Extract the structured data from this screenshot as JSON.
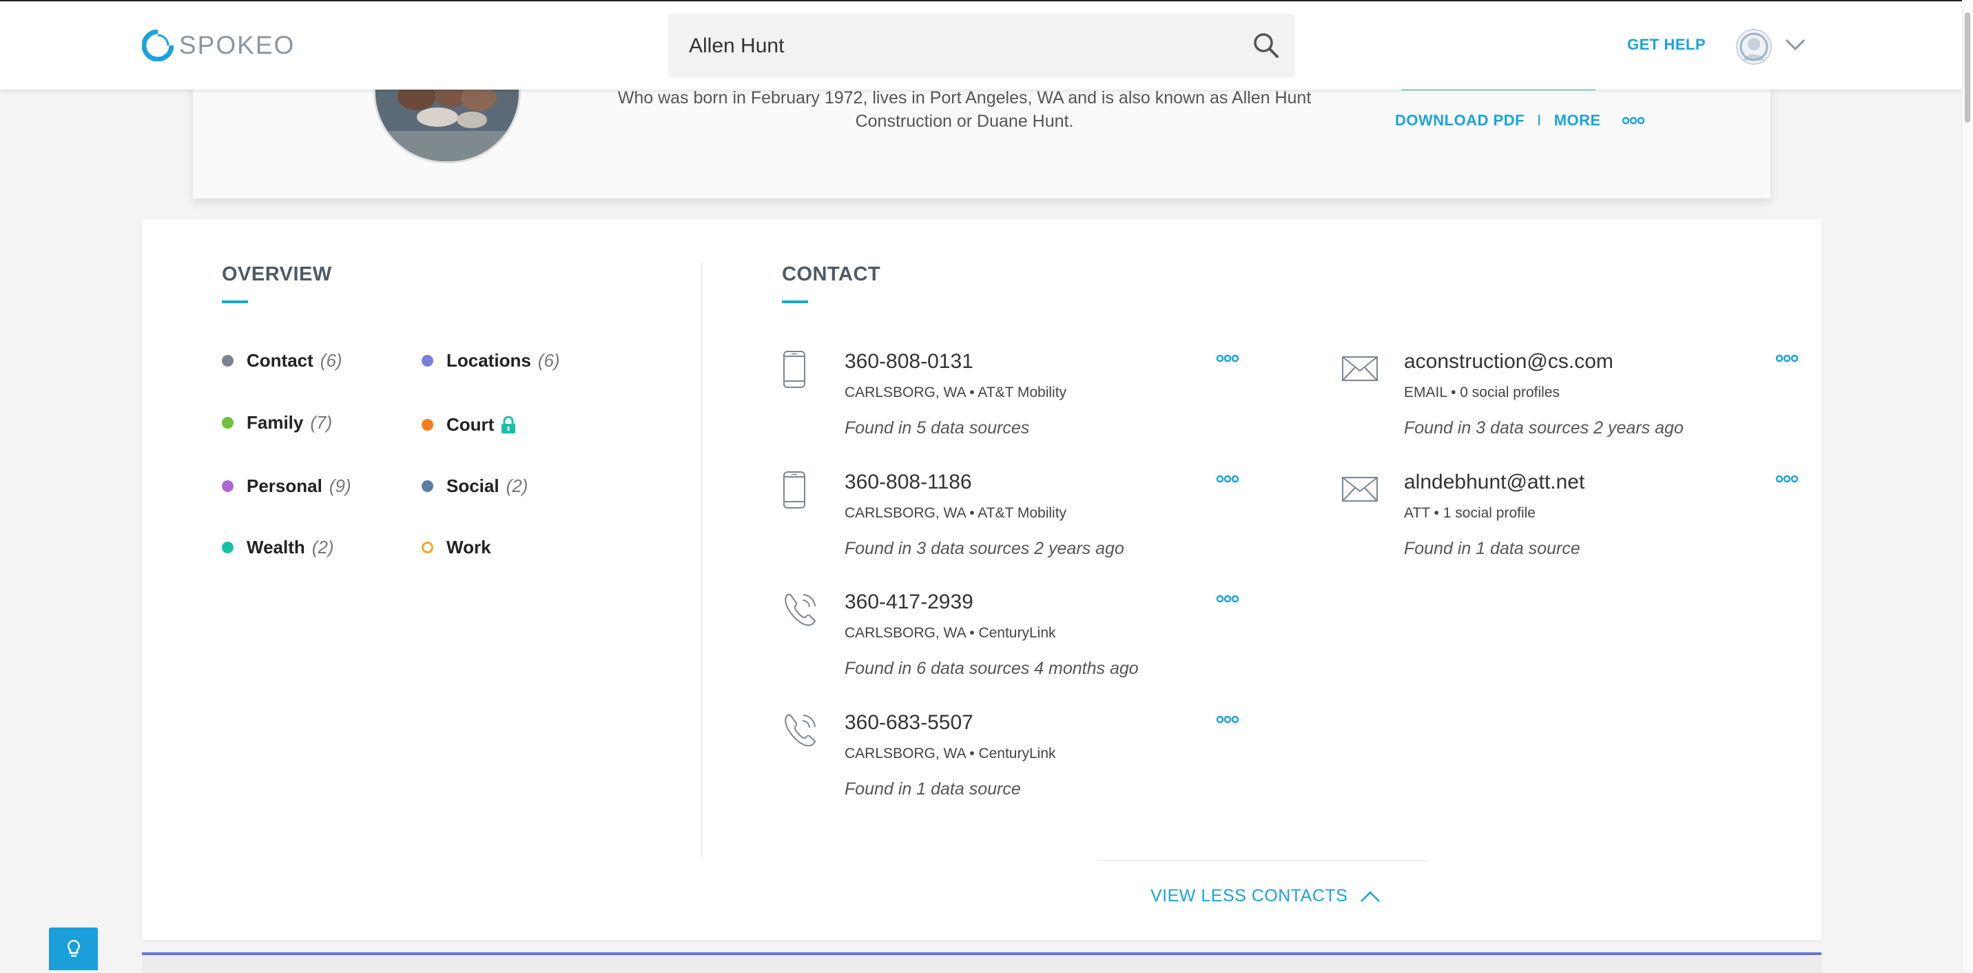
{
  "header": {
    "brand": "SPOKEO",
    "search_value": "Allen Hunt",
    "get_help": "GET HELP"
  },
  "profile": {
    "description": "Who was born in February 1972, lives in Port Angeles, WA and is also known as Allen Hunt Construction or Duane Hunt.",
    "download_pdf": "DOWNLOAD PDF",
    "separator": "I",
    "more": "MORE"
  },
  "overview": {
    "title": "OVERVIEW",
    "items": [
      {
        "label": "Contact",
        "count": "(6)",
        "color": "#7b8591"
      },
      {
        "label": "Locations",
        "count": "(6)",
        "color": "#7b7fdc"
      },
      {
        "label": "Family",
        "count": "(7)",
        "color": "#6cc23a"
      },
      {
        "label": "Court",
        "count": "",
        "color": "#f57c20",
        "locked": true
      },
      {
        "label": "Personal",
        "count": "(9)",
        "color": "#b064d8"
      },
      {
        "label": "Social",
        "count": "(2)",
        "color": "#5b7ea8"
      },
      {
        "label": "Wealth",
        "count": "(2)",
        "color": "#18c1a6"
      },
      {
        "label": "Work",
        "count": "",
        "color": "#f5a623",
        "hollow": true
      }
    ]
  },
  "contact": {
    "title": "CONTACT",
    "phones": [
      {
        "number": "360-808-0131",
        "sub": "CARLSBORG, WA • AT&T Mobility",
        "found": "Found in 5 data sources",
        "icon": "mobile-phone-icon"
      },
      {
        "number": "360-808-1186",
        "sub": "CARLSBORG, WA • AT&T Mobility",
        "found": "Found in 3 data sources 2 years ago",
        "icon": "mobile-phone-icon"
      },
      {
        "number": "360-417-2939",
        "sub": "CARLSBORG, WA • CenturyLink",
        "found": "Found in 6 data sources 4 months ago",
        "icon": "landline-phone-icon"
      },
      {
        "number": "360-683-5507",
        "sub": "CARLSBORG, WA • CenturyLink",
        "found": "Found in 1 data source",
        "icon": "landline-phone-icon"
      }
    ],
    "emails": [
      {
        "address": "aconstruction@cs.com",
        "sub": "EMAIL • 0 social profiles",
        "found": "Found in 3 data sources 2 years ago",
        "icon": "envelope-icon"
      },
      {
        "address": "alndebhunt@att.net",
        "sub": "ATT • 1 social profile",
        "found": "Found in 1 data source",
        "icon": "envelope-icon"
      }
    ],
    "view_less": "VIEW LESS CONTACTS"
  },
  "colors": {
    "accent": "#1aa3dc",
    "title": "#4c5a66",
    "cta_green": "#1bb89a",
    "bottom_strip": "#6b73d8"
  }
}
